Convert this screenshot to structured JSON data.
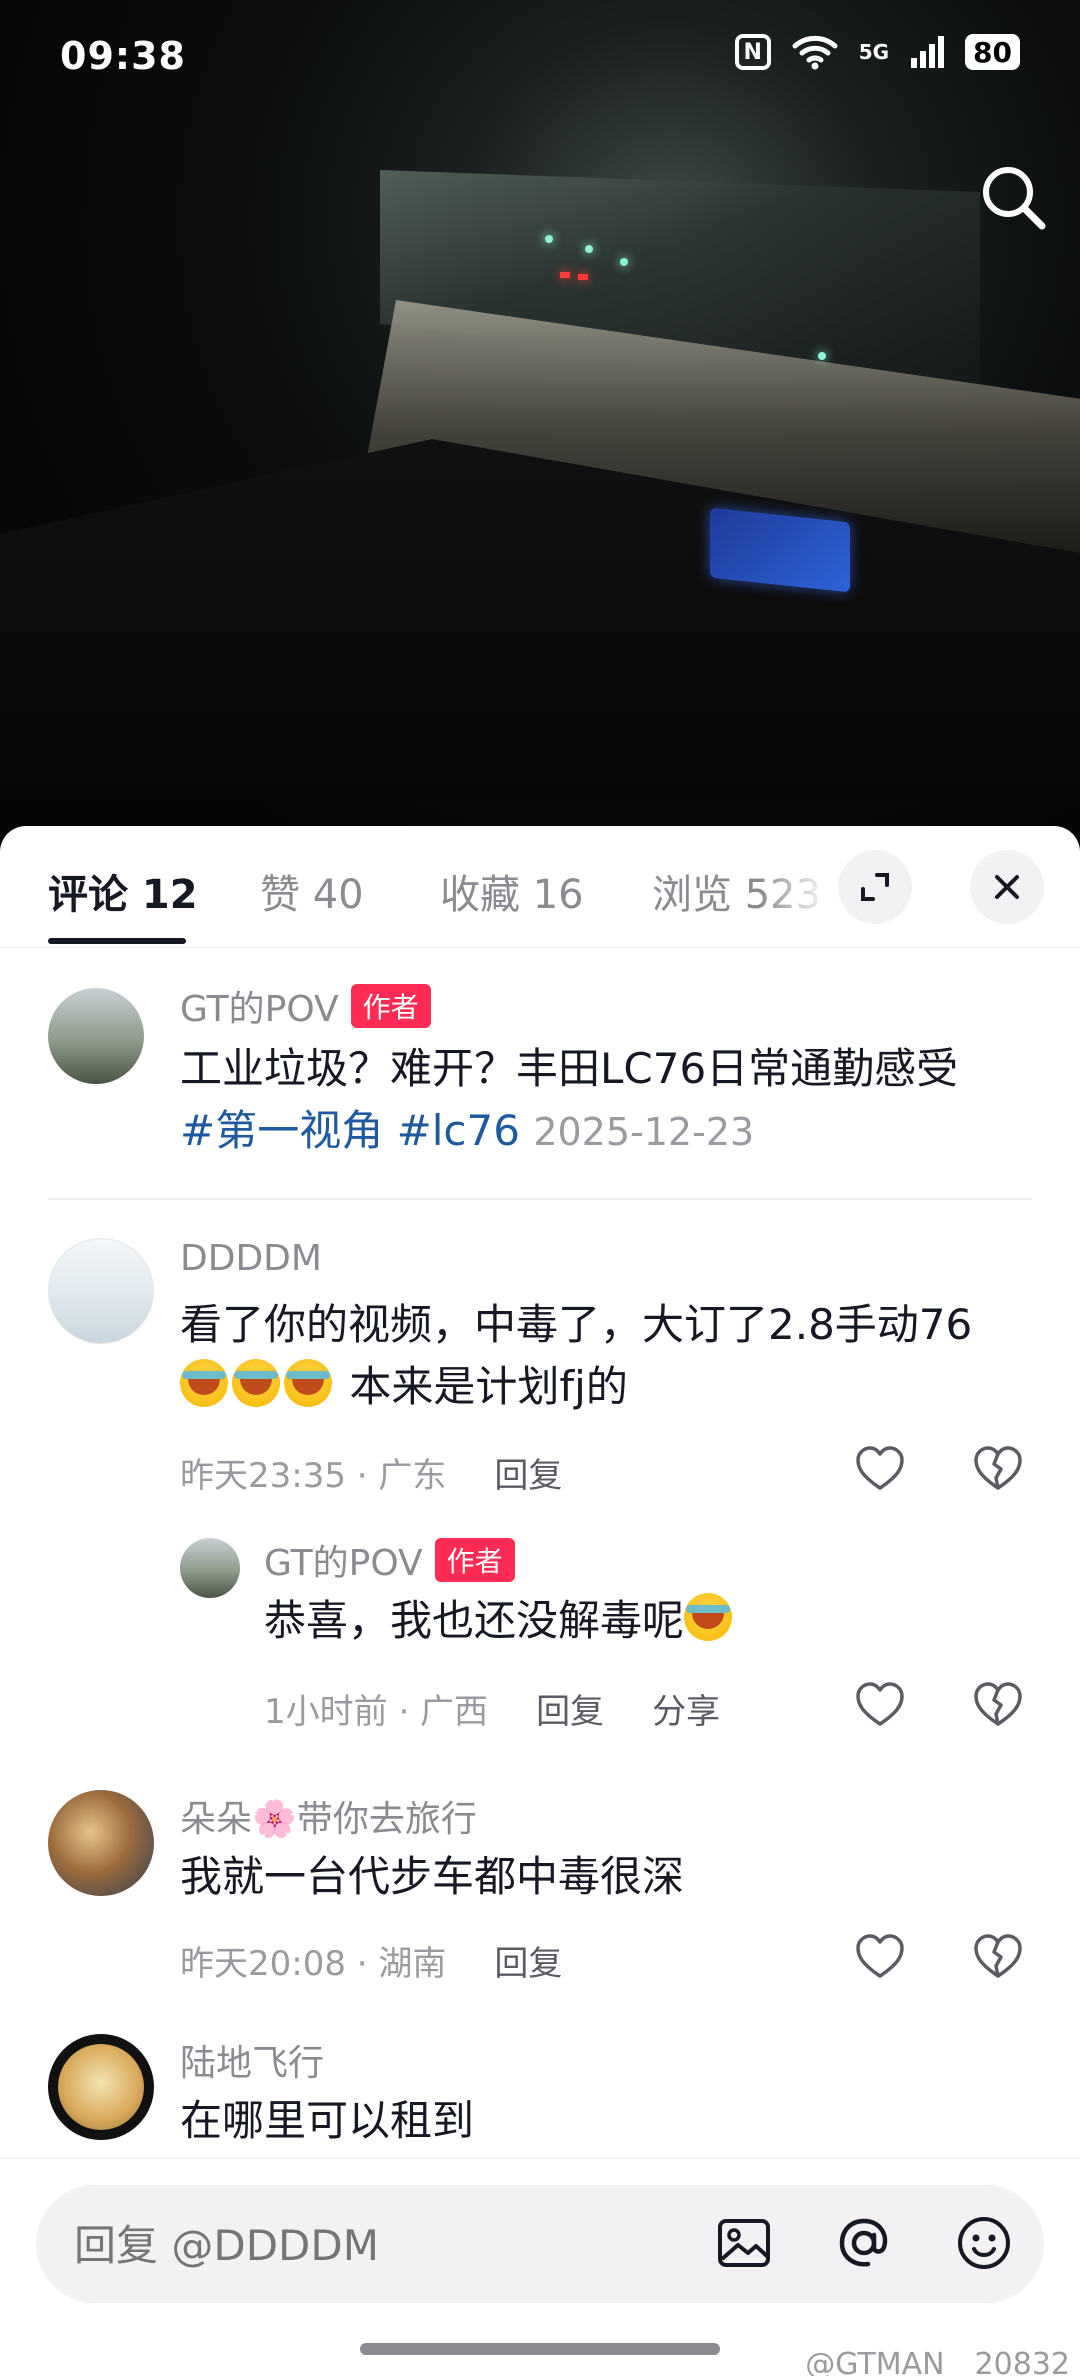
{
  "status": {
    "time": "09:38",
    "network": "5G",
    "battery": "80"
  },
  "tabs": [
    {
      "label": "评论 12"
    },
    {
      "label": "赞 40"
    },
    {
      "label": "收藏 16"
    },
    {
      "label": "浏览 523"
    }
  ],
  "post": {
    "user": "GT的POV",
    "badge": "作者",
    "text": "工业垃圾？难开？丰田LC76日常通勤感受",
    "tags": [
      "#第一视角",
      "#lc76"
    ],
    "date": "2025-12-23"
  },
  "comments": [
    {
      "user": "DDDDM",
      "text_line1": "看了你的视频，中毒了，大订了2.8手动76",
      "text_line2": "本来是计划fj的",
      "time_loc": "昨天23:35 · 广东",
      "reply_label": "回复"
    },
    {
      "user": "GT的POV",
      "badge": "作者",
      "text": "恭喜，我也还没解毒呢",
      "time_loc": "1小时前 · 广西",
      "reply_label": "回复",
      "share_label": "分享"
    },
    {
      "user": "朵朵🌸带你去旅行",
      "text": "我就一台代步车都中毒很深",
      "time_loc": "昨天20:08 · 湖南",
      "reply_label": "回复"
    },
    {
      "user": "陆地飞行",
      "text": "在哪里可以租到"
    }
  ],
  "input": {
    "placeholder": "回复 @DDDDM"
  },
  "watermark": "@GTMAN__20832"
}
